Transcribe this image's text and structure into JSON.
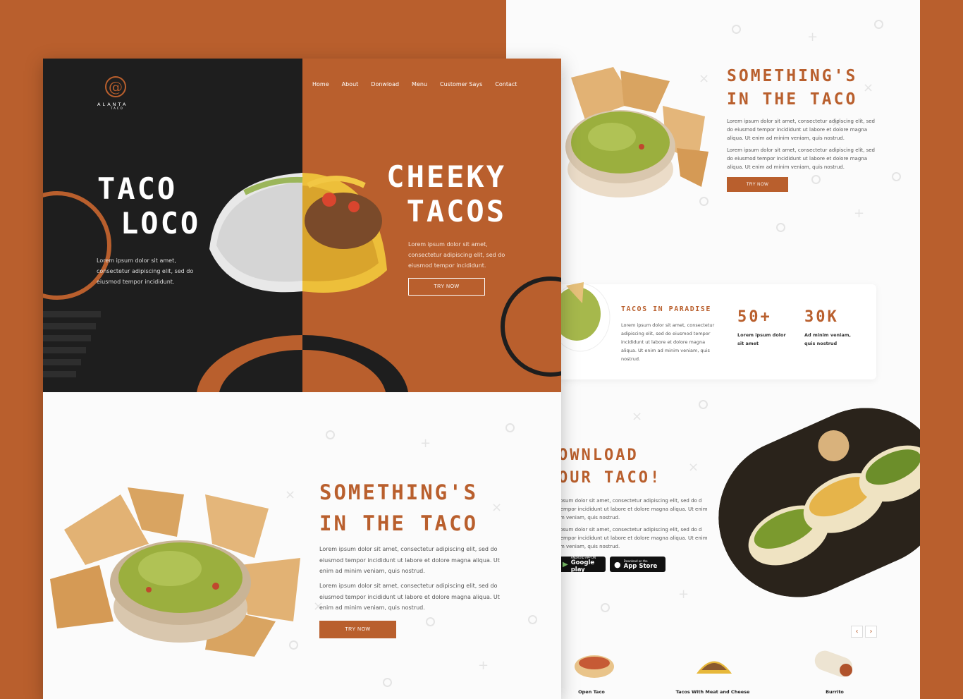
{
  "colors": {
    "accent": "#B95F2D",
    "dark": "#1E1E1E",
    "bg": "#FBFBFB"
  },
  "logo": {
    "mark": "@",
    "name": "ALANTA",
    "sub": "TACO"
  },
  "nav": [
    "Home",
    "About",
    "Donwload",
    "Menu",
    "Customer Says",
    "Contact"
  ],
  "hero": {
    "left_title_1": "TACO",
    "left_title_2": "LOCO",
    "left_text": "Lorem ipsum dolor sit amet, consectetur adipiscing elit, sed do eiusmod tempor incididunt.",
    "right_title_1": "CHEEKY",
    "right_title_2": "TACOS",
    "right_text": "Lorem ipsum dolor sit amet, consectetur adipiscing elit, sed do eiusmod tempor incididunt.",
    "button": "TRY NOW"
  },
  "section2": {
    "title_1": "SOMETHING'S",
    "title_2": "IN THE TACO",
    "para_1": "Lorem ipsum dolor sit amet, consectetur adipiscing elit, sed do eiusmod tempor incididunt ut labore et dolore magna aliqua. Ut enim ad minim veniam, quis nostrud.",
    "para_2": "Lorem ipsum dolor sit amet, consectetur adipiscing elit, sed do eiusmod tempor incididunt ut labore et dolore magna aliqua. Ut enim ad minim veniam, quis nostrud.",
    "button": "TRY NOW"
  },
  "back": {
    "title_1": "SOMETHING'S",
    "title_2": "IN THE TACO",
    "para_1": "Lorem ipsum dolor sit amet, consectetur adipiscing elit, sed do eiusmod tempor incididunt ut labore et dolore magna aliqua. Ut enim ad minim veniam, quis nostrud.",
    "para_2": "Lorem ipsum dolor sit amet, consectetur adipiscing elit, sed do eiusmod tempor incididunt ut labore et dolore magna aliqua. Ut enim ad minim veniam, quis nostrud.",
    "button": "TRY NOW",
    "stats": {
      "title": "TACOS IN PARADISE",
      "text": "Lorem ipsum dolor sit amet, consectetur adipiscing elit, sed do eiusmod tempor incididunt ut labore et dolore magna aliqua. Ut enim ad minim veniam, quis nostrud.",
      "num_1": "50+",
      "label_1": "Lorem ipsum dolor sit amet",
      "num_2": "30K",
      "label_2": "Ad minim veniam, quis nostrud"
    },
    "download": {
      "title_1": "OWNLOAD",
      "title_2": "OUR TACO!",
      "para_1": "ipsum dolor sit amet, consectetur adipiscing elit, sed do d tempor incididunt ut labore et dolore magna aliqua. Ut enim im veniam, quis nostrud.",
      "para_2": "ipsum dolor sit amet, consectetur adipiscing elit, sed do d tempor incididunt ut labore et dolore magna aliqua. Ut enim im veniam, quis nostrud.",
      "google_small": "ANDROID APP ON",
      "google_big": "Google play",
      "apple_small": "Download on the",
      "apple_big": "App Store"
    },
    "carousel": {
      "prev": "‹",
      "next": "›"
    },
    "products": [
      "Open Taco",
      "Tacos With Meat and Cheese",
      "Burrito"
    ]
  }
}
